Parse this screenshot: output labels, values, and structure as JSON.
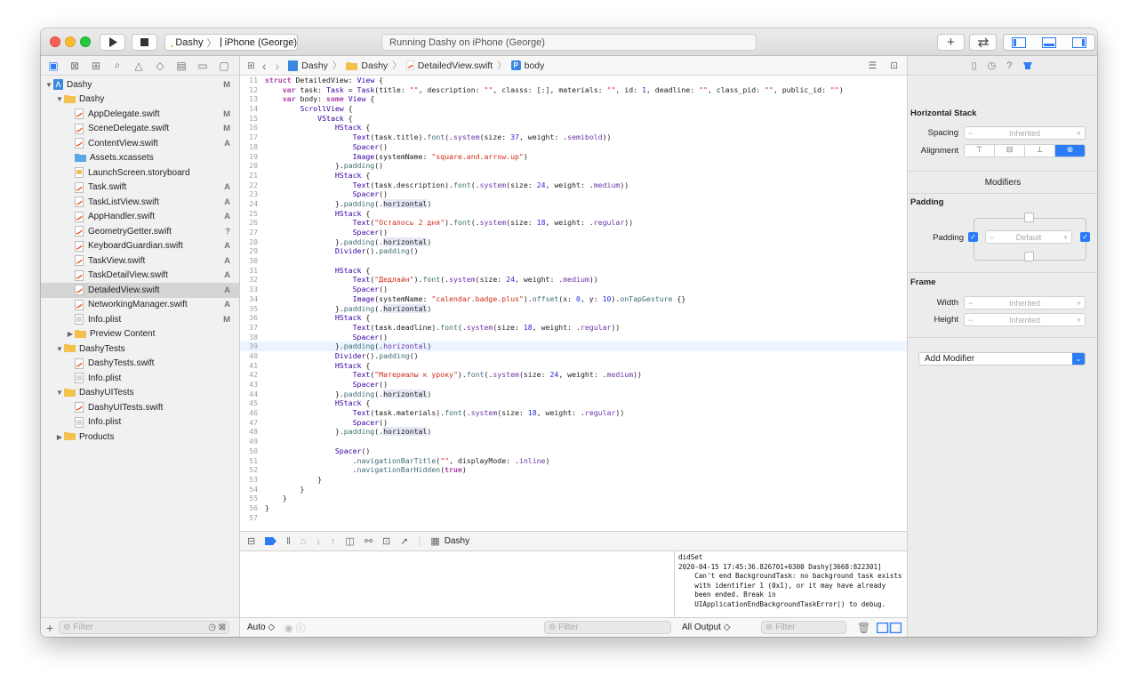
{
  "toolbar": {
    "scheme_name": "Dashy",
    "device_name": "iPhone (George)",
    "activity_text": "Running Dashy on iPhone (George)"
  },
  "navigator": {
    "tree": [
      {
        "label": "Dashy",
        "indent": 0,
        "type": "project",
        "disclosure": "open",
        "status": "M"
      },
      {
        "label": "Dashy",
        "indent": 1,
        "type": "folder",
        "disclosure": "open",
        "status": ""
      },
      {
        "label": "AppDelegate.swift",
        "indent": 2,
        "type": "swift",
        "disclosure": "",
        "status": "M"
      },
      {
        "label": "SceneDelegate.swift",
        "indent": 2,
        "type": "swift",
        "disclosure": "",
        "status": "M"
      },
      {
        "label": "ContentView.swift",
        "indent": 2,
        "type": "swift",
        "disclosure": "",
        "status": "A"
      },
      {
        "label": "Assets.xcassets",
        "indent": 2,
        "type": "assets",
        "disclosure": "",
        "status": ""
      },
      {
        "label": "LaunchScreen.storyboard",
        "indent": 2,
        "type": "storyboard",
        "disclosure": "",
        "status": ""
      },
      {
        "label": "Task.swift",
        "indent": 2,
        "type": "swift",
        "disclosure": "",
        "status": "A"
      },
      {
        "label": "TaskListView.swift",
        "indent": 2,
        "type": "swift",
        "disclosure": "",
        "status": "A"
      },
      {
        "label": "AppHandler.swift",
        "indent": 2,
        "type": "swift",
        "disclosure": "",
        "status": "A"
      },
      {
        "label": "GeometryGetter.swift",
        "indent": 2,
        "type": "swift",
        "disclosure": "",
        "status": "?"
      },
      {
        "label": "KeyboardGuardian.swift",
        "indent": 2,
        "type": "swift",
        "disclosure": "",
        "status": "A"
      },
      {
        "label": "TaskView.swift",
        "indent": 2,
        "type": "swift",
        "disclosure": "",
        "status": "A"
      },
      {
        "label": "TaskDetailView.swift",
        "indent": 2,
        "type": "swift",
        "disclosure": "",
        "status": "A"
      },
      {
        "label": "DetailedView.swift",
        "indent": 2,
        "type": "swift",
        "disclosure": "",
        "status": "A",
        "selected": true
      },
      {
        "label": "NetworkingManager.swift",
        "indent": 2,
        "type": "swift",
        "disclosure": "",
        "status": "A"
      },
      {
        "label": "Info.plist",
        "indent": 2,
        "type": "plist",
        "disclosure": "",
        "status": "M"
      },
      {
        "label": "Preview Content",
        "indent": 2,
        "type": "folder",
        "disclosure": "closed",
        "status": ""
      },
      {
        "label": "DashyTests",
        "indent": 1,
        "type": "folder",
        "disclosure": "open",
        "status": ""
      },
      {
        "label": "DashyTests.swift",
        "indent": 2,
        "type": "swift",
        "disclosure": "",
        "status": ""
      },
      {
        "label": "Info.plist",
        "indent": 2,
        "type": "plist",
        "disclosure": "",
        "status": ""
      },
      {
        "label": "DashyUITests",
        "indent": 1,
        "type": "folder",
        "disclosure": "open",
        "status": ""
      },
      {
        "label": "DashyUITests.swift",
        "indent": 2,
        "type": "swift",
        "disclosure": "",
        "status": ""
      },
      {
        "label": "Info.plist",
        "indent": 2,
        "type": "plist",
        "disclosure": "",
        "status": ""
      },
      {
        "label": "Products",
        "indent": 1,
        "type": "folder",
        "disclosure": "closed",
        "status": ""
      }
    ],
    "filter_placeholder": "Filter"
  },
  "jumpbar": {
    "items": [
      "Dashy",
      "Dashy",
      "DetailedView.swift",
      "body"
    ]
  },
  "code": {
    "current_line": 39,
    "lines": [
      {
        "n": 11,
        "t": "[[kw:struct]] DetailedView: [[ty:View]] {"
      },
      {
        "n": 12,
        "t": "    [[kw:var]] task: [[ty:Task]] = [[ty:Task]](title: [[st:\"\"]], description: [[st:\"\"]], classs: [:], materials: [[st:\"\"]], id: [[num:1]], deadline: [[st:\"\"]], class_pid: [[st:\"\"]], public_id: [[st:\"\"]])"
      },
      {
        "n": 13,
        "t": "    [[kw:var]] body: [[kw:some]] [[ty:View]] {"
      },
      {
        "n": 14,
        "t": "        [[ty:ScrollView]] {"
      },
      {
        "n": 15,
        "t": "            [[ty:VStack]] {"
      },
      {
        "n": 16,
        "t": "                [[ty:HStack]] {"
      },
      {
        "n": 17,
        "t": "                    [[ty:Text]](task.title).[[fn:font]](.[[pp:system]](size: [[num:37]], weight: .[[pp:semibold]]))"
      },
      {
        "n": 18,
        "t": "                    [[ty:Spacer]]()"
      },
      {
        "n": 19,
        "t": "                    [[ty:Image]](systemName: [[st:\"square.and.arrow.up\"]])"
      },
      {
        "n": 20,
        "t": "                }.[[fn:padding]]()"
      },
      {
        "n": 21,
        "t": "                [[ty:HStack]] {"
      },
      {
        "n": 22,
        "t": "                    [[ty:Text]](task.description).[[fn:font]](.[[pp:system]](size: [[num:24]], weight: .[[pp:medium]]))"
      },
      {
        "n": 23,
        "t": "                    [[ty:Spacer]]()"
      },
      {
        "n": 24,
        "t": "                }.[[fn:padding]](.[[sel:horizontal]])"
      },
      {
        "n": 25,
        "t": "                [[ty:HStack]] {"
      },
      {
        "n": 26,
        "t": "                    [[ty:Text]]([[st:\"Осталось 2 дня\"]]).[[fn:font]](.[[pp:system]](size: [[num:18]], weight: .[[pp:regular]]))"
      },
      {
        "n": 27,
        "t": "                    [[ty:Spacer]]()"
      },
      {
        "n": 28,
        "t": "                }.[[fn:padding]](.[[sel:horizontal]])"
      },
      {
        "n": 29,
        "t": "                [[ty:Divider]]().[[fn:padding]]()"
      },
      {
        "n": 30,
        "t": ""
      },
      {
        "n": 31,
        "t": "                [[ty:HStack]] {"
      },
      {
        "n": 32,
        "t": "                    [[ty:Text]]([[st:\"Дедлайн\"]]).[[fn:font]](.[[pp:system]](size: [[num:24]], weight: .[[pp:medium]]))"
      },
      {
        "n": 33,
        "t": "                    [[ty:Spacer]]()"
      },
      {
        "n": 34,
        "t": "                    [[ty:Image]](systemName: [[st:\"calendar.badge.plus\"]]).[[fn:offset]](x: [[num:0]], y: [[num:10]]).[[fn:onTapGesture]] {}"
      },
      {
        "n": 35,
        "t": "                }.[[fn:padding]](.[[sel:horizontal]])"
      },
      {
        "n": 36,
        "t": "                [[ty:HStack]] {"
      },
      {
        "n": 37,
        "t": "                    [[ty:Text]](task.deadline).[[fn:font]](.[[pp:system]](size: [[num:18]], weight: .[[pp:regular]]))"
      },
      {
        "n": 38,
        "t": "                    [[ty:Spacer]]()"
      },
      {
        "n": 39,
        "t": "                }.[[fn:padding]](.[[pp:horizontal]])"
      },
      {
        "n": 40,
        "t": "                [[ty:Divider]]().[[fn:padding]]()"
      },
      {
        "n": 41,
        "t": "                [[ty:HStack]] {"
      },
      {
        "n": 42,
        "t": "                    [[ty:Text]]([[st:\"Материалы к уроку\"]]).[[fn:font]](.[[pp:system]](size: [[num:24]], weight: .[[pp:medium]]))"
      },
      {
        "n": 43,
        "t": "                    [[ty:Spacer]]()"
      },
      {
        "n": 44,
        "t": "                }.[[fn:padding]](.[[sel:horizontal]])"
      },
      {
        "n": 45,
        "t": "                [[ty:HStack]] {"
      },
      {
        "n": 46,
        "t": "                    [[ty:Text]](task.materials).[[fn:font]](.[[pp:system]](size: [[num:18]], weight: .[[pp:regular]]))"
      },
      {
        "n": 47,
        "t": "                    [[ty:Spacer]]()"
      },
      {
        "n": 48,
        "t": "                }.[[fn:padding]](.[[sel:horizontal]])"
      },
      {
        "n": 49,
        "t": ""
      },
      {
        "n": 50,
        "t": "                [[ty:Spacer]]()"
      },
      {
        "n": 51,
        "t": "                    .[[fn:navigationBarTitle]]([[st:\"\"]], displayMode: .[[pp:inline]])"
      },
      {
        "n": 52,
        "t": "                    .[[fn:navigationBarHidden]]([[kw:true]])"
      },
      {
        "n": 53,
        "t": "            }"
      },
      {
        "n": 54,
        "t": "        }"
      },
      {
        "n": 55,
        "t": "    }"
      },
      {
        "n": 56,
        "t": "}"
      },
      {
        "n": 57,
        "t": ""
      }
    ]
  },
  "debug": {
    "target_label": "Dashy",
    "auto_label": "Auto ◇",
    "filter_placeholder": "Filter",
    "output_label": "All Output ◇",
    "console_text": "didSet\n2020-04-15 17:45:36.826701+0300 Dashy[3668:822301]\n    Can't end BackgroundTask: no background task exists\n    with identifier 1 (0x1), or it may have already\n    been ended. Break in\n    UIApplicationEndBackgroundTaskError() to debug."
  },
  "inspector": {
    "stack_title": "Horizontal Stack",
    "spacing_label": "Spacing",
    "spacing_value": "Inherited",
    "alignment_label": "Alignment",
    "modifiers_title": "Modifiers",
    "padding_title": "Padding",
    "padding_label": "Padding",
    "padding_value": "Default",
    "frame_title": "Frame",
    "width_label": "Width",
    "width_value": "Inherited",
    "height_label": "Height",
    "height_value": "Inherited",
    "add_modifier_label": "Add Modifier"
  },
  "colors": {
    "accent": "#2c7cf6",
    "selection_row": "#d4d4d4",
    "current_line": "#ecf5ff"
  }
}
